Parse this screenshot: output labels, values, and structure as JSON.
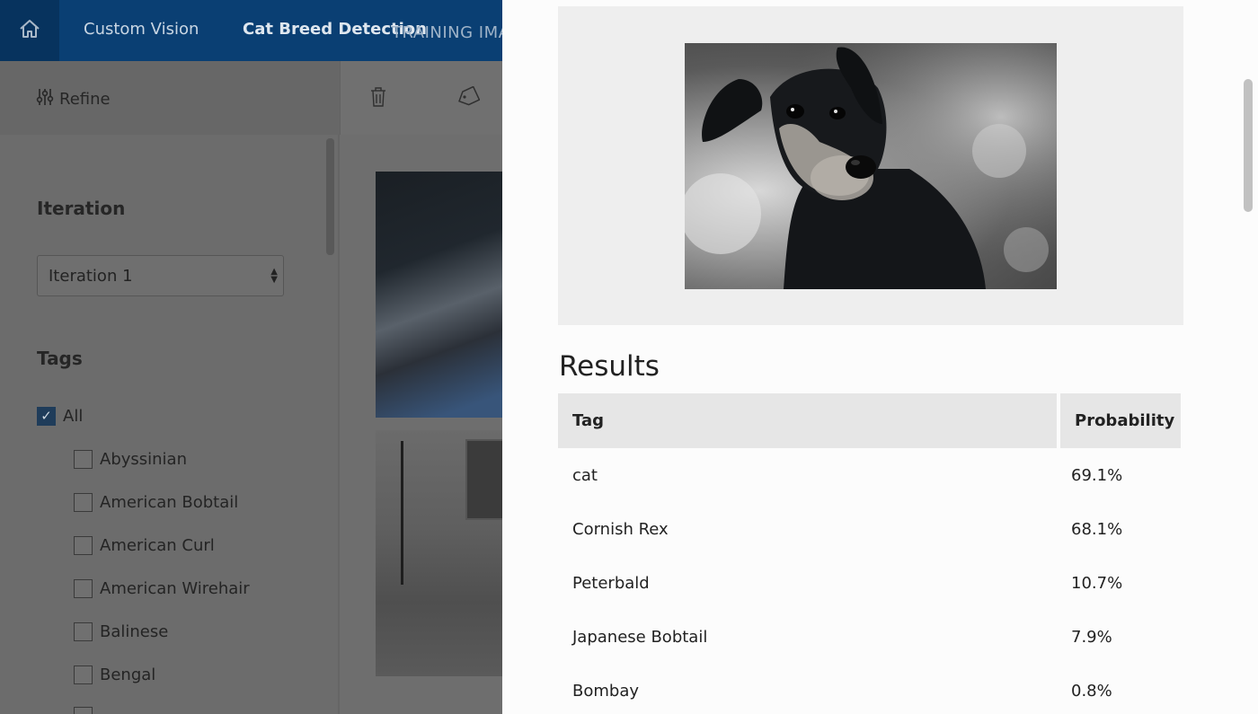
{
  "topbar": {
    "home_icon": "home-icon",
    "app_name": "Custom Vision",
    "project_name": "Cat Breed Detection",
    "section_label": "TRAINING IMA"
  },
  "toolbar": {
    "refine_label": "Refine",
    "refine_icon": "sliders-icon",
    "delete_icon": "trash-icon",
    "tag_icon": "tag-icon"
  },
  "sidebar": {
    "iteration_heading": "Iteration",
    "iteration_selected": "Iteration 1",
    "tags_heading": "Tags",
    "tags": [
      {
        "label": "All",
        "checked": true
      },
      {
        "label": "Abyssinian",
        "checked": false
      },
      {
        "label": "American Bobtail",
        "checked": false
      },
      {
        "label": "American Curl",
        "checked": false
      },
      {
        "label": "American Wirehair",
        "checked": false
      },
      {
        "label": "Balinese",
        "checked": false
      },
      {
        "label": "Bengal",
        "checked": false
      }
    ]
  },
  "results": {
    "title": "Results",
    "columns": [
      "Tag",
      "Probability"
    ],
    "rows": [
      {
        "tag": "cat",
        "probability": "69.1%"
      },
      {
        "tag": "Cornish Rex",
        "probability": "68.1%"
      },
      {
        "tag": "Peterbald",
        "probability": "10.7%"
      },
      {
        "tag": "Japanese Bobtail",
        "probability": "7.9%"
      },
      {
        "tag": "Bombay",
        "probability": "0.8%"
      }
    ]
  },
  "colors": {
    "topbar": "#0a3f73",
    "checkbox_checked": "#1f3c5a",
    "table_header": "#e6e6e6"
  }
}
